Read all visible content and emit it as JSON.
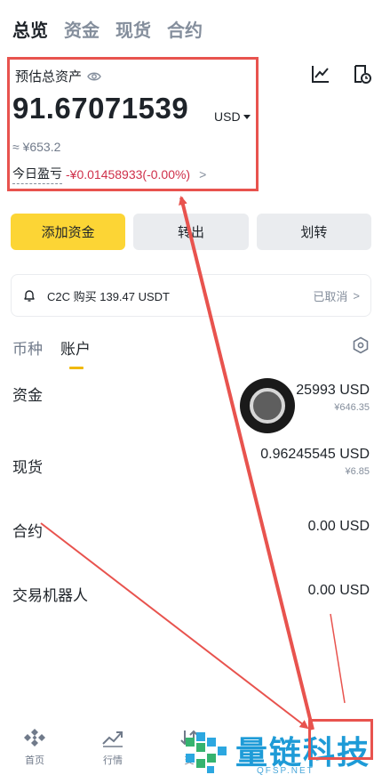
{
  "top_tabs": [
    "总览",
    "资金",
    "现货",
    "合约"
  ],
  "balance": {
    "label": "预估总资产",
    "value": "91.67071539",
    "unit": "USD",
    "cny": "≈ ¥653.2",
    "pnl_label": "今日盈亏",
    "pnl_value": "-¥0.01458933(-0.00%)",
    "pnl_arrow": ">"
  },
  "buttons": {
    "deposit": "添加资金",
    "withdraw": "转出",
    "transfer": "划转"
  },
  "notice": {
    "text": "C2C 购买 139.47 USDT",
    "status": "已取消",
    "arrow": ">"
  },
  "sub_tabs": [
    "币种",
    "账户"
  ],
  "accounts": [
    {
      "name": "资金",
      "value": "25993 USD",
      "sub": "¥646.35"
    },
    {
      "name": "现货",
      "value": "0.96245545 USD",
      "sub": "¥6.85"
    },
    {
      "name": "合约",
      "value": "0.00 USD",
      "sub": ""
    },
    {
      "name": "交易机器人",
      "value": "0.00 USD",
      "sub": ""
    }
  ],
  "nav": [
    "首页",
    "行情",
    "交"
  ],
  "watermark": {
    "title": "量链科技",
    "sub": "QFSP.NET"
  },
  "colors": {
    "accent": "#fcd535",
    "negative": "#cf304a",
    "annotation": "#e8534e",
    "watermark": "#1e9bd7"
  }
}
